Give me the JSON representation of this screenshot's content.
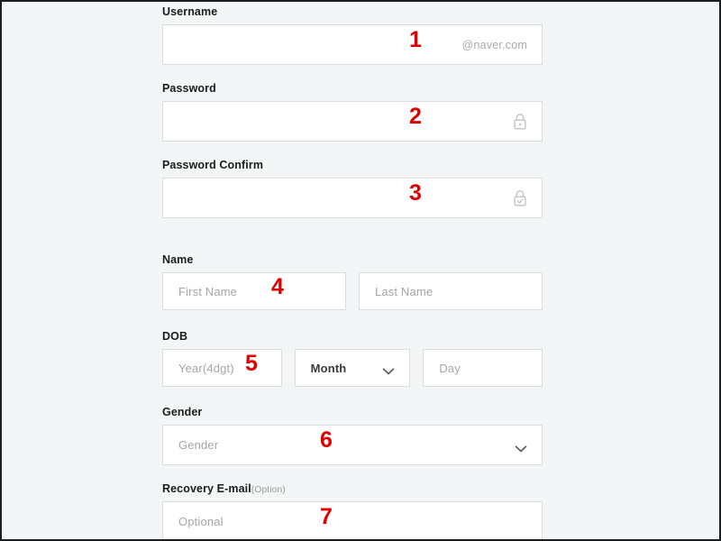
{
  "page": {
    "background_color": "#f4f5f7",
    "border_color": "#1d1d1d",
    "marker_color": "#e00000"
  },
  "form": {
    "fields": [
      {
        "id": "username",
        "label": "Username",
        "placeholder": "",
        "suffix": "@naver.com",
        "marker": "1"
      },
      {
        "id": "password",
        "label": "Password",
        "placeholder": "",
        "icon": "lock-icon",
        "marker": "2"
      },
      {
        "id": "password-confirm",
        "label": "Password Confirm",
        "placeholder": "",
        "icon": "lock-check-icon",
        "marker": "3"
      },
      {
        "id": "name",
        "label": "Name",
        "first_name_placeholder": "First Name",
        "last_name_placeholder": "Last Name",
        "marker": "4"
      },
      {
        "id": "dob",
        "label": "DOB",
        "year_placeholder": "Year(4dgt)",
        "month_value": "Month",
        "day_placeholder": "Day",
        "marker": "5"
      },
      {
        "id": "gender",
        "label": "Gender",
        "value": "Gender",
        "marker": "6"
      },
      {
        "id": "recovery-email",
        "label": "Recovery E-mail",
        "label_note": "(Option)",
        "placeholder": "Optional",
        "marker": "7"
      }
    ]
  }
}
